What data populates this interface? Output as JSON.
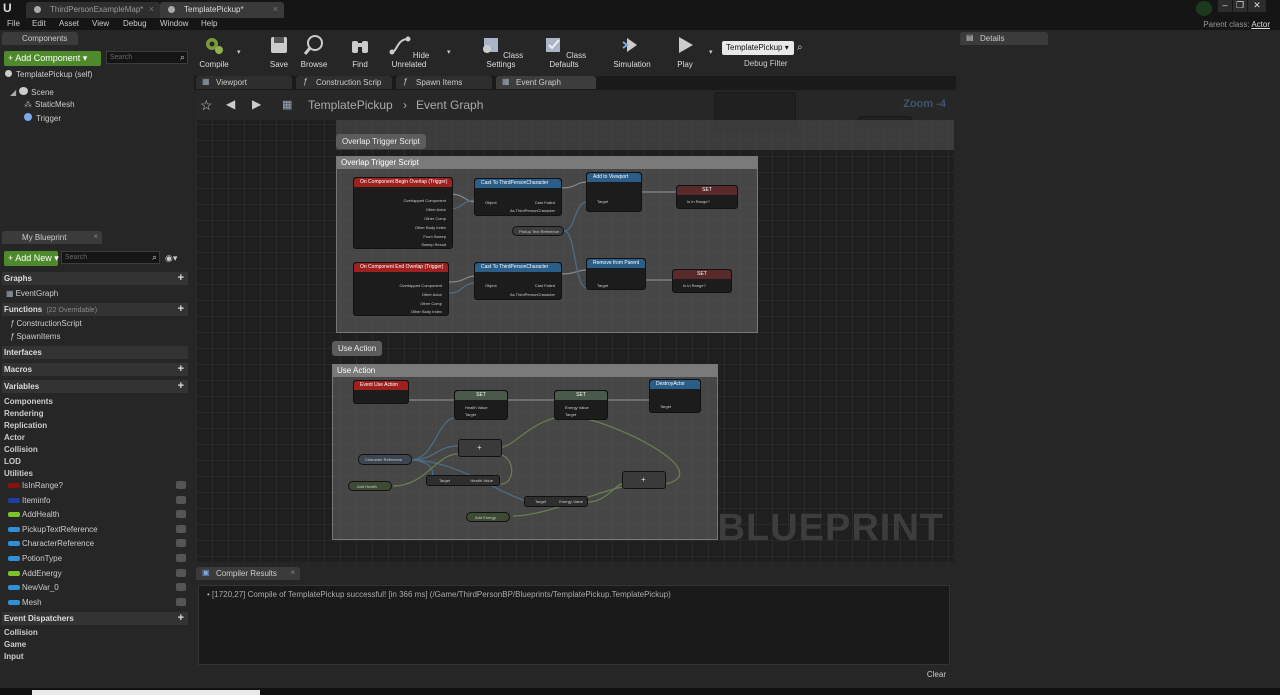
{
  "window": {
    "tabs": [
      {
        "label": "ThirdPersonExampleMap*"
      },
      {
        "label": "TemplatePickup*"
      }
    ],
    "menu": [
      "File",
      "Edit",
      "Asset",
      "View",
      "Debug",
      "Window",
      "Help"
    ],
    "parent_class_label": "Parent class:",
    "parent_class_value": "Actor"
  },
  "components": {
    "tab": "Components",
    "add_button": "+ Add Component ▾",
    "search_placeholder": "Search",
    "self_item": "TemplatePickup (self)",
    "tree": [
      "Scene",
      "StaticMesh",
      "Trigger"
    ]
  },
  "my_blueprint": {
    "tab": "My Blueprint",
    "add_button": "+ Add New ▾",
    "search_placeholder": "Search",
    "graphs_label": "Graphs",
    "event_graph": "EventGraph",
    "functions_label": "Functions",
    "functions_overridable": "(22 Overridable)",
    "functions": [
      "ConstructionScript",
      "SpawnItems"
    ],
    "interfaces_label": "Interfaces",
    "macros_label": "Macros",
    "variables_label": "Variables",
    "variable_categories": [
      "Components",
      "Rendering",
      "Replication",
      "Actor",
      "Collision",
      "LOD",
      "Utilities"
    ],
    "variables": [
      {
        "name": "IsInRange?",
        "color": "#8a1010"
      },
      {
        "name": "Iteminfo",
        "color": "#1f3fa8"
      },
      {
        "name": "AddHealth",
        "color": "#7dc22a"
      },
      {
        "name": "PickupTextReference",
        "color": "#2f8fd8"
      },
      {
        "name": "CharacterReference",
        "color": "#2f8fd8"
      },
      {
        "name": "PotionType",
        "color": "#2f8fd8"
      },
      {
        "name": "AddEnergy",
        "color": "#7dc22a"
      },
      {
        "name": "NewVar_0",
        "color": "#2f8fd8"
      },
      {
        "name": "Mesh",
        "color": "#2f8fd8"
      }
    ],
    "event_dispatchers_label": "Event Dispatchers",
    "dispatcher_categories": [
      "Collision",
      "Game",
      "Input"
    ]
  },
  "toolbar": {
    "compile": "Compile",
    "save": "Save",
    "browse": "Browse",
    "find": "Find",
    "hide_unrelated": "Hide Unrelated",
    "class_settings": "Class Settings",
    "class_defaults": "Class Defaults",
    "simulation": "Simulation",
    "play": "Play",
    "debug_select": "TemplatePickup ▾",
    "debug_filter": "Debug Filter"
  },
  "editor_tabs": [
    "Viewport",
    "Construction Scrip",
    "Spawn Items",
    "Event Graph"
  ],
  "breadcrumb": {
    "root": "TemplatePickup",
    "current": "Event Graph"
  },
  "graph": {
    "zoom": "Zoom -4",
    "watermark": "BLUEPRINT",
    "comment1_bubble": "Overlap Trigger Script",
    "comment1_title": "Overlap Trigger Script",
    "comment2_bubble": "Use Action",
    "comment2_title": "Use Action",
    "nodes": {
      "begin_overlap": "On Component Begin Overlap (Trigger)",
      "end_overlap": "On Component End Overlap (Trigger)",
      "cast1": "Cast To ThirdPersonCharacter",
      "cast2": "Cast To ThirdPersonCharacter",
      "add_viewport": "Add to Viewport",
      "remove_parent": "Remove from Parent",
      "set1": "SET",
      "set2": "SET",
      "pickup_ref": "Pickup Text Reference",
      "event_use": "Event Use Action",
      "set_health": "SET",
      "set_energy": "SET",
      "destroy": "DestroyActor",
      "char_ref": "Character Reference",
      "add_health": "Add Health",
      "add_energy": "Add Energy",
      "target_health": "Target",
      "target_energy": "Target",
      "plus1": "+",
      "plus2": "+"
    },
    "pins": {
      "overlapped": "Overlapped Component",
      "other_actor": "Other Actor",
      "other_comp": "Other Comp",
      "other_body": "Other Body Index",
      "from_sweep": "From Sweep",
      "sweep_result": "Sweep Result",
      "object": "Object",
      "cast_failed": "Cast Failed",
      "as_tpc": "As ThirdPersonCharacter",
      "target": "Target",
      "is_in_range": "Is In Range?",
      "health_value": "Health Value",
      "energy_value": "Energy Value"
    }
  },
  "compiler": {
    "tab": "Compiler Results",
    "message": "[1720,27] Compile of TemplatePickup successful! [in 366 ms] (/Game/ThirdPersonBP/Blueprints/TemplatePickup.TemplatePickup)",
    "clear": "Clear"
  },
  "details": {
    "tab": "Details"
  }
}
